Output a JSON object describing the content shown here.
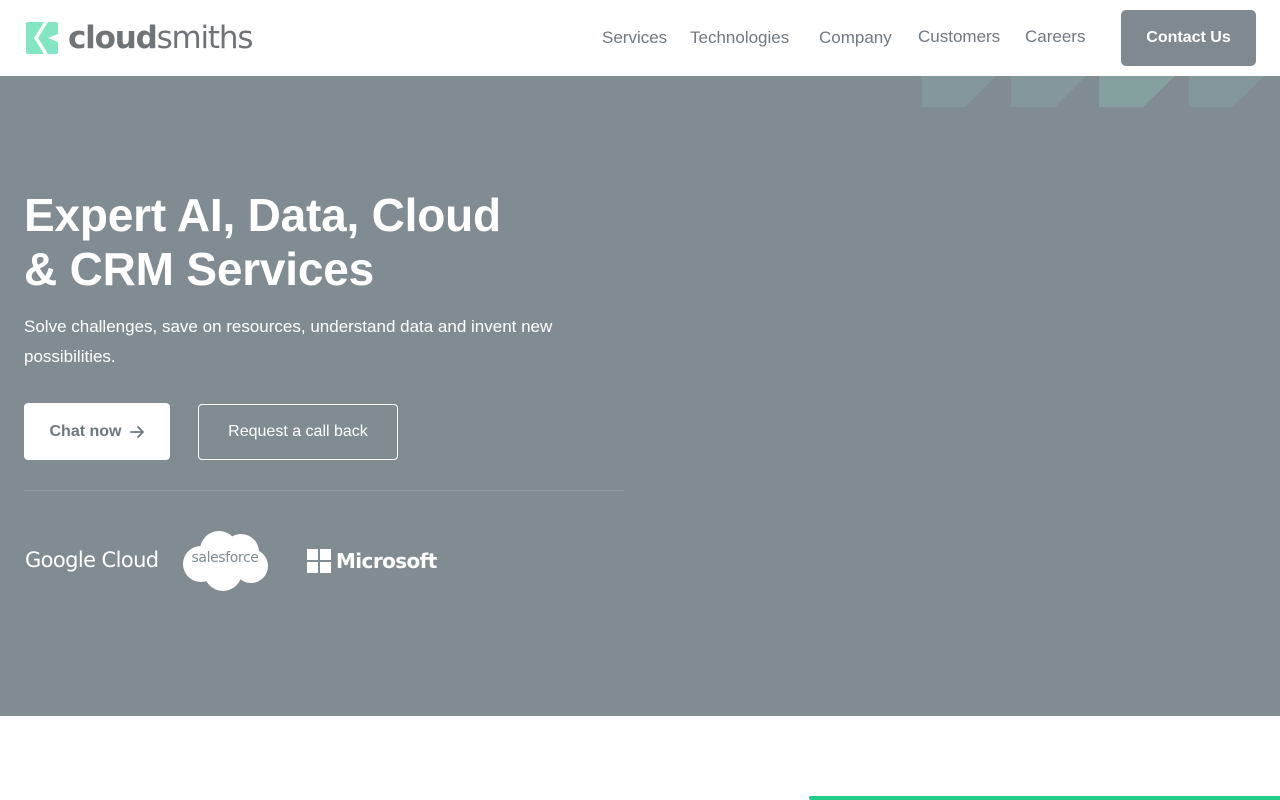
{
  "brand": {
    "bold": "cloud",
    "light": "smiths",
    "mark_color": "#83e6c2"
  },
  "nav": {
    "items": [
      "Services",
      "Technologies",
      "Company",
      "Customers",
      "Careers"
    ],
    "contact_label": "Contact Us"
  },
  "hero": {
    "title_line1": "Expert AI, Data, Cloud",
    "title_line2": "& CRM Services",
    "subtitle": "Solve challenges, save on resources, understand data and invent new possibilities.",
    "chat_label": "Chat now",
    "callback_label": "Request a call back",
    "background_color": "#808c92"
  },
  "partners": {
    "google": "Google Cloud",
    "salesforce": "salesforce",
    "microsoft": "Microsoft"
  },
  "colors": {
    "accent": "#21cc87",
    "button_gray": "#7f898f"
  }
}
